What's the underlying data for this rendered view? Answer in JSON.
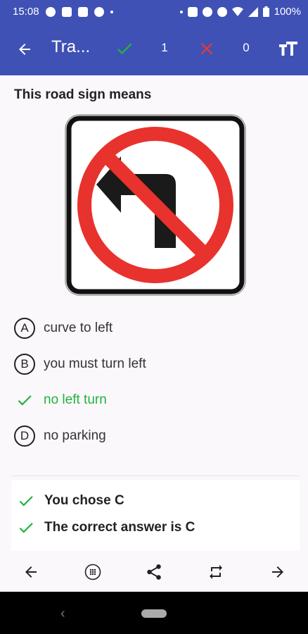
{
  "status_bar": {
    "time": "15:08",
    "battery": "100%"
  },
  "app_bar": {
    "title": "Tra...",
    "correct_count": "1",
    "wrong_count": "0",
    "icons": [
      "back-arrow-icon",
      "check-icon",
      "cross-icon",
      "text-size-icon"
    ],
    "colors": {
      "primary": "#3f51b5",
      "check": "#22b23d",
      "cross": "#e53935"
    }
  },
  "question": {
    "text": "This road sign means",
    "sign": "no-left-turn-sign"
  },
  "options": [
    {
      "letter": "A",
      "label": "curve to left",
      "state": "default"
    },
    {
      "letter": "B",
      "label": "you must turn left",
      "state": "default"
    },
    {
      "letter": "C",
      "label": "no left turn",
      "state": "correct"
    },
    {
      "letter": "D",
      "label": "no parking",
      "state": "default"
    }
  ],
  "result": {
    "chosen": "You chose C",
    "correct": "The correct answer is C"
  },
  "bottom_bar": {
    "icons": [
      "prev-arrow-icon",
      "grid-icon",
      "share-icon",
      "repeat-icon",
      "next-arrow-icon"
    ]
  }
}
